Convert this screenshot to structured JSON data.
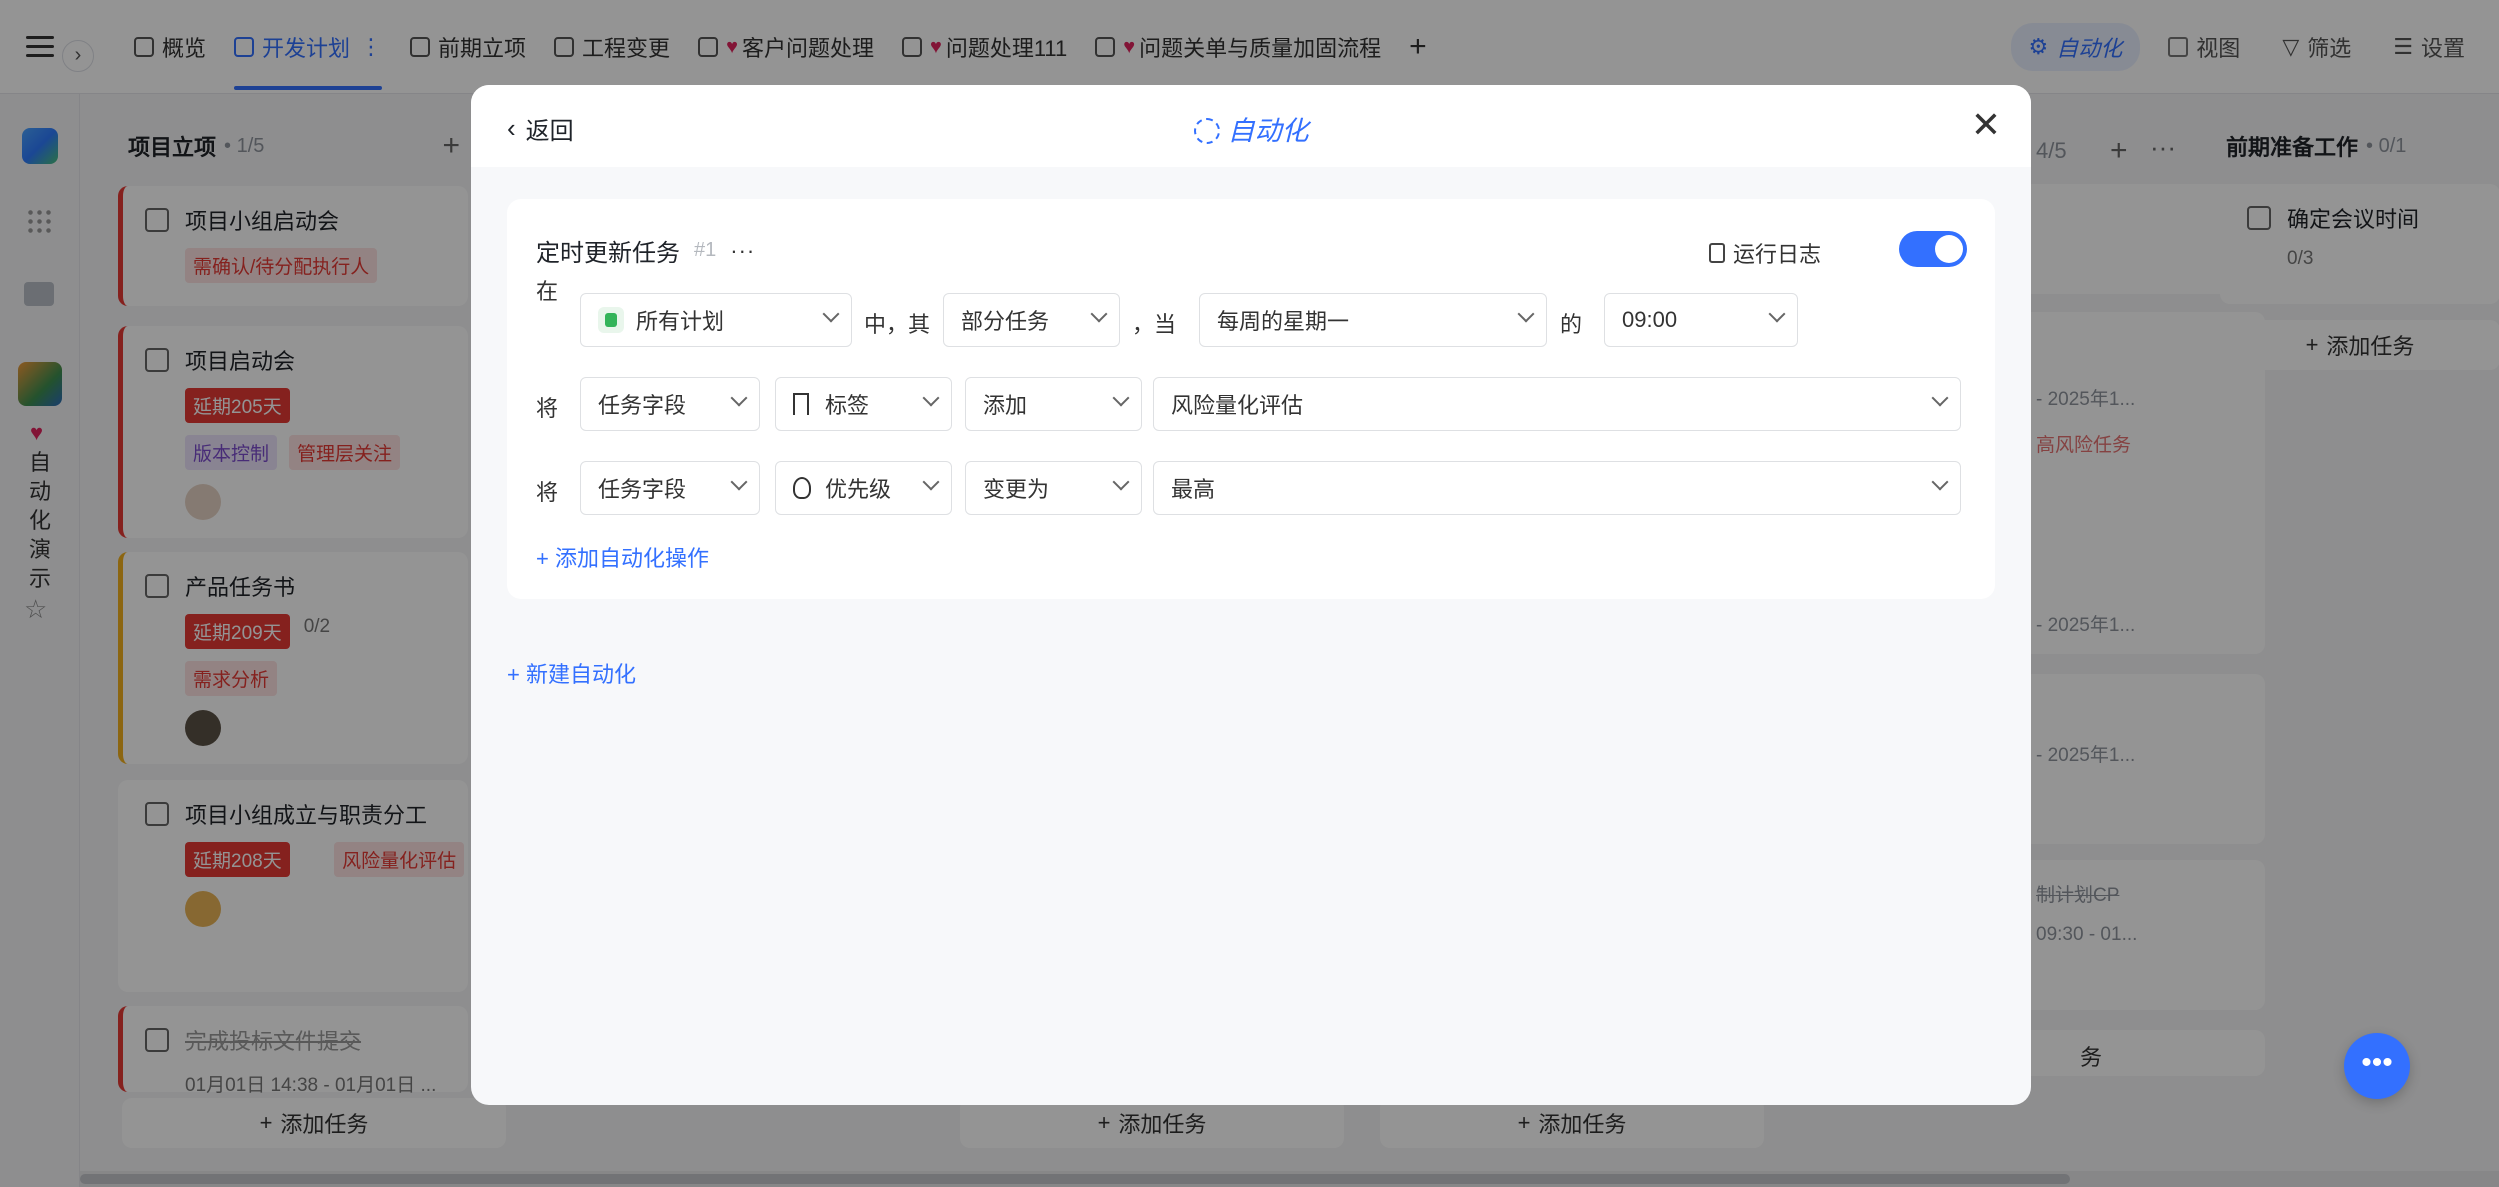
{
  "app": {
    "tabs": [
      {
        "label": "概览"
      },
      {
        "label": "开发计划"
      },
      {
        "label": "前期立项"
      },
      {
        "label": "工程变更"
      },
      {
        "label": "客户问题处理"
      },
      {
        "label": "问题处理111"
      },
      {
        "label": "问题关单与质量加固流程"
      }
    ],
    "automation_label": "自动化",
    "view_label": "视图",
    "filter_label": "筛选",
    "settings_label": "设置",
    "sidebar_vertical_text": "自动化演示",
    "columns": [
      {
        "title": "项目立项",
        "count": "• 1/5"
      },
      {
        "title": "前期准备工作",
        "count": "• 0/1"
      }
    ],
    "partial_column_count": "4/5",
    "cards": [
      {
        "title": "项目小组启动会",
        "tags": [
          "需确认/待分配执行人"
        ]
      },
      {
        "title": "项目启动会",
        "overdue": "延期205天",
        "tags": [
          "版本控制",
          "管理层关注"
        ]
      },
      {
        "title": "产品任务书",
        "overdue": "延期209天",
        "subtasks": "0/2",
        "tags": [
          "需求分析"
        ]
      },
      {
        "title": "项目小组成立与职责分工",
        "overdue": "延期208天",
        "tags": [
          "风险量化评估"
        ]
      },
      {
        "title": "完成投标文件提交",
        "date": "01月01日 14:38 - 01月01日 ..."
      }
    ],
    "right_card": {
      "title": "确定会议时间",
      "subtasks": "0/3"
    },
    "add_task_label": "添加任务",
    "ghost_texts": [
      "- 2025年1...",
      "高风险任务",
      "- 2025年1...",
      "- 2025年1...",
      "制计划CP",
      "09:30 - 01...",
      "务"
    ]
  },
  "modal": {
    "back_label": "返回",
    "title": "自动化",
    "rule": {
      "name": "定时更新任务",
      "number": "#1",
      "run_log_label": "运行日志",
      "enabled": true,
      "trigger": {
        "in_label": "在",
        "plan": "所有计划",
        "middle_label": "中，其",
        "scope": "部分任务",
        "when_label": "，当",
        "schedule": "每周的星期一",
        "of_label": "的",
        "time": "09:00"
      },
      "actions": [
        {
          "prefix": "将",
          "field_type": "任务字段",
          "field": "标签",
          "operation": "添加",
          "value": "风险量化评估"
        },
        {
          "prefix": "将",
          "field_type": "任务字段",
          "field": "优先级",
          "operation": "变更为",
          "value": "最高"
        }
      ],
      "add_action_label": "添加自动化操作"
    },
    "new_automation_label": "新建自动化"
  }
}
